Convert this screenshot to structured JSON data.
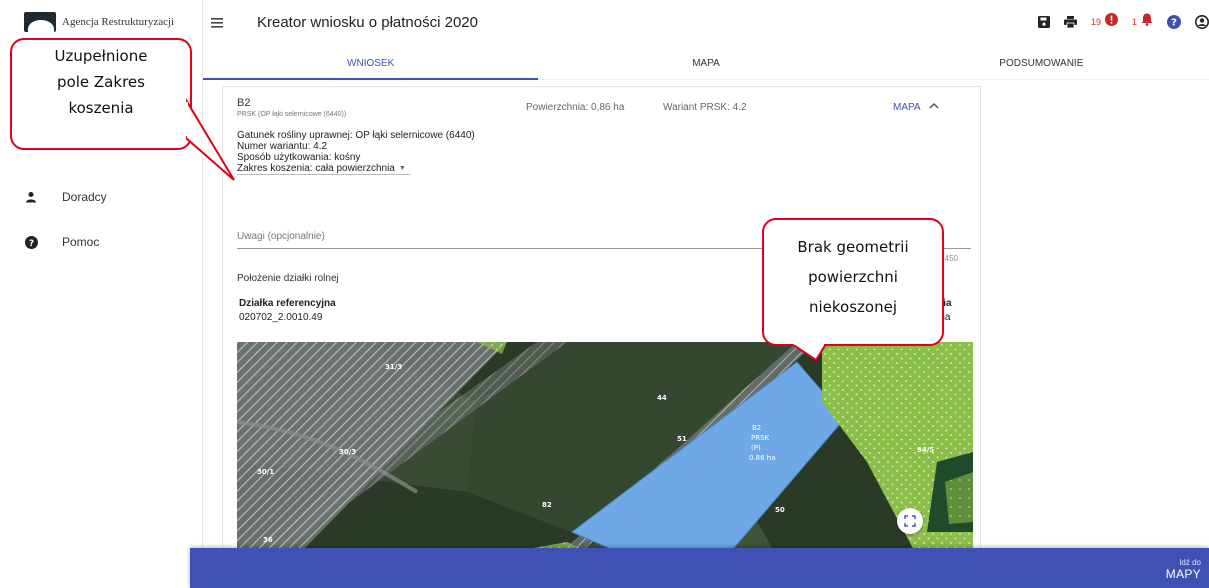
{
  "agency": {
    "logo_text": "Agencja Restrukturyzacji"
  },
  "sidebar": {
    "items": [
      {
        "label": "Doradcy",
        "icon": "person-icon"
      },
      {
        "label": "Pomoc",
        "icon": "help-circle-icon"
      }
    ]
  },
  "header": {
    "title": "Kreator wniosku o płatności 2020",
    "errors_count": "19",
    "notifications_count": "1",
    "icons": [
      "menu-icon",
      "save-icon",
      "print-icon",
      "error-icon",
      "bell-icon",
      "help-icon",
      "account-icon"
    ]
  },
  "tabs": [
    {
      "label": "WNIOSEK",
      "active": true
    },
    {
      "label": "MAPA",
      "active": false
    },
    {
      "label": "PODSUMOWANIE",
      "active": false
    }
  ],
  "plot": {
    "name": "B2",
    "subtitle": "PRSK (OP łąki selernicowe (6440))",
    "area": "Powierzchnia: 0,86 ha",
    "variant": "Wariant PRSK: 4.2",
    "map_link": "MAPA",
    "species": "Gatunek rośliny uprawnej: OP łąki selernicowe (6440)",
    "variant_number": "Numer wariantu: 4.2",
    "usage": "Sposób użytkowania: kośny",
    "mowing_scope": "Zakres koszenia: cała powierzchnia"
  },
  "notes": {
    "placeholder": "Uwagi (opcjonalnie)",
    "counter": "0 / 450"
  },
  "location": {
    "title": "Położenie działki rolnej",
    "ref_label": "Działka referencyjna",
    "ref_value": "020702_2.0010.49",
    "right_label_partial": "hnia",
    "right_value_partial": "6 ha"
  },
  "map": {
    "labels": [
      "31/3",
      "44",
      "51",
      "30/3",
      "30/1",
      "82",
      "50",
      "36",
      "94/5",
      "B2",
      "PRSK",
      "(P)",
      "0.86 ha"
    ],
    "colors": {
      "selected_parcel": "#6fa8e6",
      "dotted_zone": "#8cbf4a",
      "hatched": "#9aa0a0",
      "field_dark": "#2e3d29"
    }
  },
  "bottom": {
    "small": "Idź do",
    "big": "MAPY"
  },
  "callouts": [
    {
      "text_lines": [
        "Uzupełnione",
        "pole Zakres",
        "koszenia"
      ]
    },
    {
      "text_lines": [
        "Brak geometrii",
        "powierzchni",
        "niekoszonej"
      ]
    }
  ],
  "colors": {
    "accent": "#3f51b5",
    "error": "#d32f2f",
    "callout_border": "#e0001b"
  }
}
